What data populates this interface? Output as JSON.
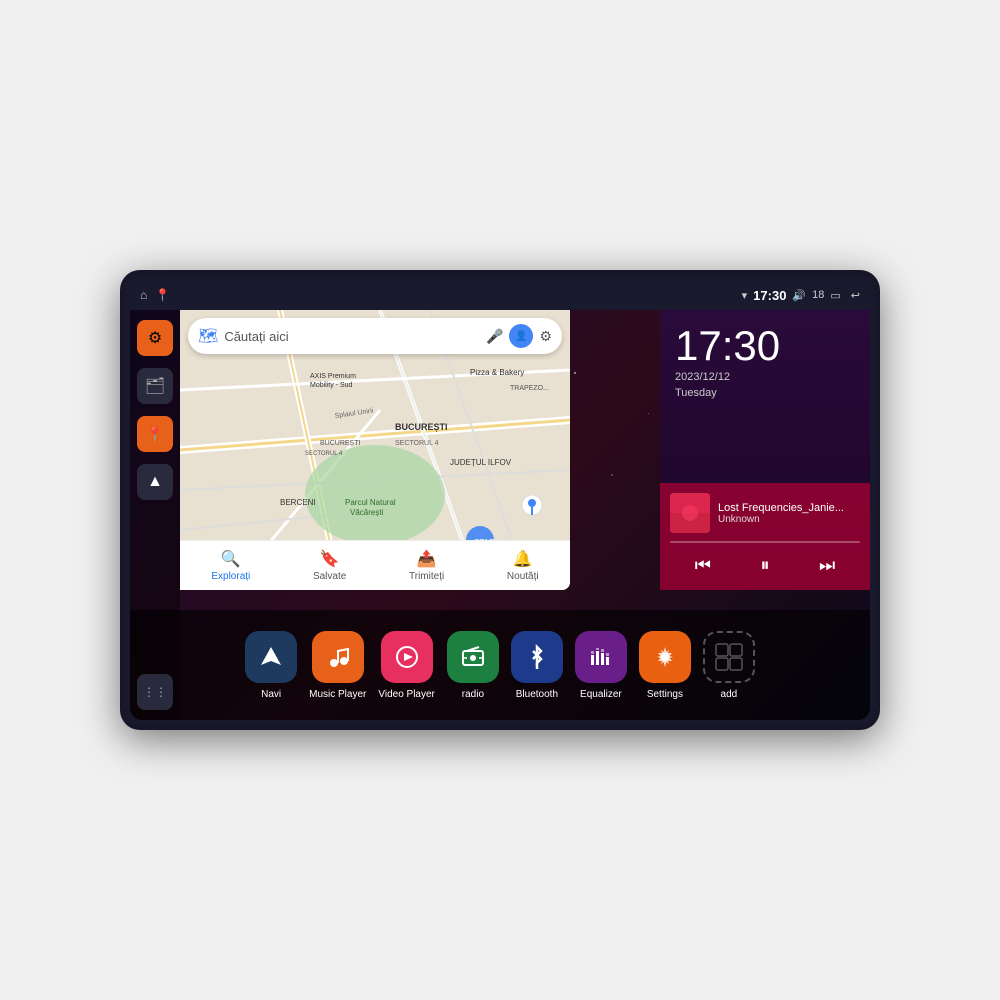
{
  "device": {
    "status_bar": {
      "time": "17:30",
      "signal_icon": "📶",
      "volume_icon": "🔊",
      "battery_level": "18",
      "battery_icon": "🔋",
      "back_icon": "↩",
      "home_icon": "⌂",
      "maps_icon": "📍"
    },
    "clock": {
      "time": "17:30",
      "date": "2023/12/12",
      "day": "Tuesday"
    },
    "music": {
      "track_name": "Lost Frequencies_Janie...",
      "artist": "Unknown",
      "prev_icon": "⏮",
      "play_pause_icon": "⏸",
      "next_icon": "⏭"
    },
    "map": {
      "search_placeholder": "Căutați aici",
      "bottom_nav": [
        {
          "label": "Explorați",
          "icon": "🔍",
          "active": true
        },
        {
          "label": "Salvate",
          "icon": "🔖",
          "active": false
        },
        {
          "label": "Trimiteți",
          "icon": "📤",
          "active": false
        },
        {
          "label": "Noutăți",
          "icon": "🔔",
          "active": false
        }
      ]
    },
    "apps": [
      {
        "id": "navi",
        "label": "Navi",
        "icon": "▲",
        "color": "#1e3a5f"
      },
      {
        "id": "music-player",
        "label": "Music Player",
        "icon": "🎵",
        "color": "#e8611a"
      },
      {
        "id": "video-player",
        "label": "Video Player",
        "icon": "▶",
        "color": "#e83060"
      },
      {
        "id": "radio",
        "label": "radio",
        "icon": "📡",
        "color": "#1e8040"
      },
      {
        "id": "bluetooth",
        "label": "Bluetooth",
        "icon": "⚡",
        "color": "#1e3a8a"
      },
      {
        "id": "equalizer",
        "label": "Equalizer",
        "icon": "🎛",
        "color": "#6a1e8a"
      },
      {
        "id": "settings",
        "label": "Settings",
        "icon": "⚙",
        "color": "#e86010"
      },
      {
        "id": "add",
        "label": "add",
        "icon": "+",
        "color": "transparent"
      }
    ],
    "sidebar": [
      {
        "icon": "⚙",
        "color": "#e8611a",
        "label": "settings"
      },
      {
        "icon": "🗂",
        "color": "#2a3a4e",
        "label": "files"
      },
      {
        "icon": "📍",
        "color": "#e8611a",
        "label": "maps"
      },
      {
        "icon": "▲",
        "color": "#2a3a4e",
        "label": "navigation"
      },
      {
        "icon": "⋮⋮⋮",
        "color": "#2a3a4e",
        "label": "apps"
      }
    ]
  }
}
